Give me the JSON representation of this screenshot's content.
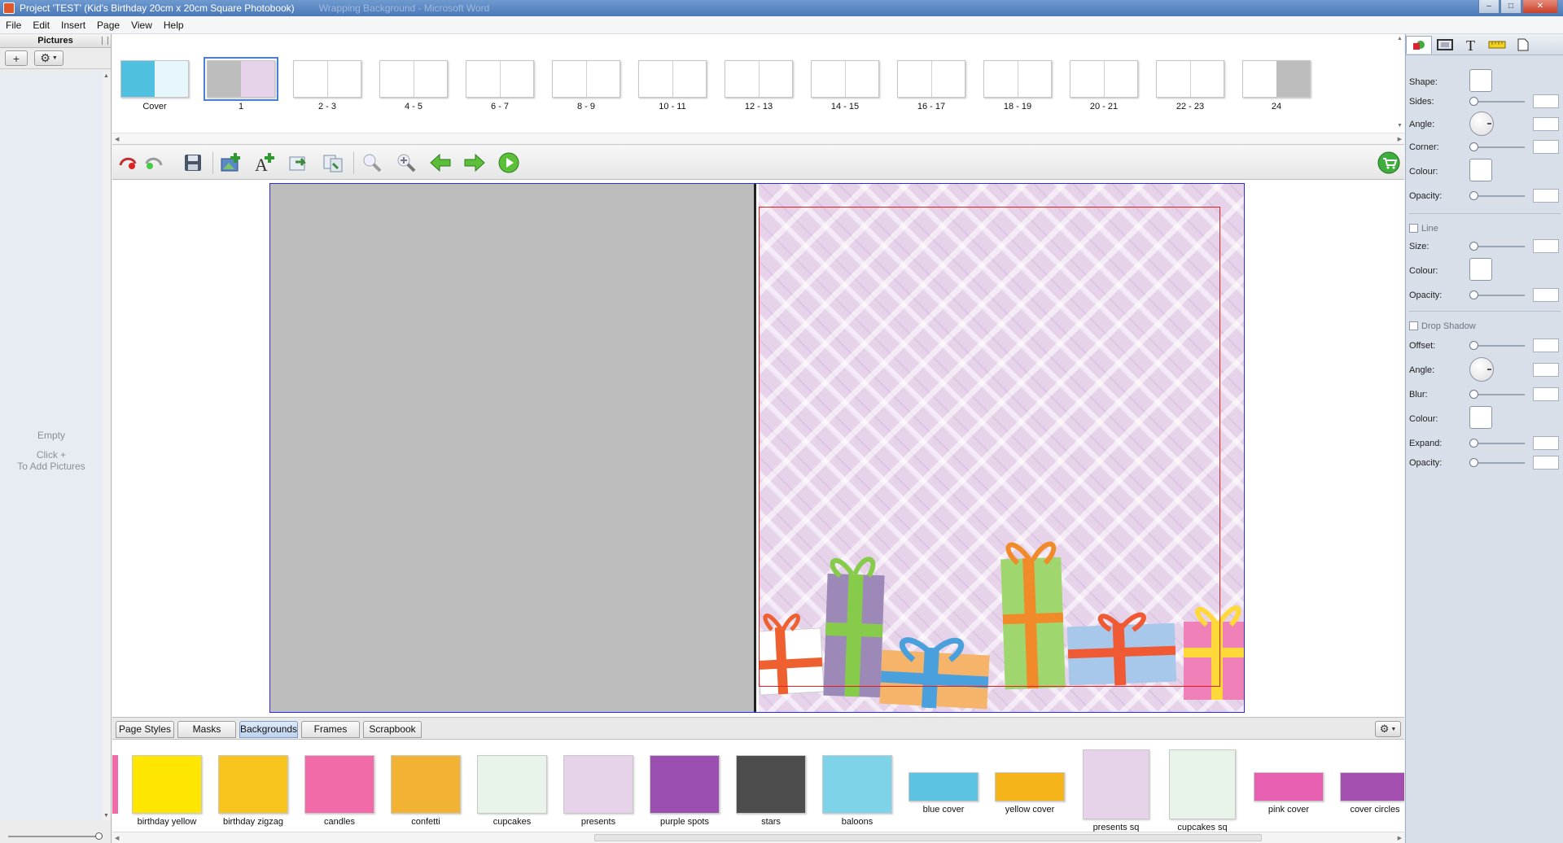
{
  "window": {
    "title": "Project 'TEST' (Kid's Birthday 20cm x 20cm Square Photobook)",
    "background_title": "Wrapping Background - Microsoft Word",
    "controls": [
      "minimize",
      "maximize",
      "close"
    ]
  },
  "menubar": [
    "File",
    "Edit",
    "Insert",
    "Page",
    "View",
    "Help"
  ],
  "pictures_panel": {
    "title": "Pictures",
    "add_label": "+",
    "settings_icon": "gear-icon",
    "empty_text": "Empty",
    "hint_line1": "Click +",
    "hint_line2": "To Add Pictures"
  },
  "page_strip": {
    "pages": [
      {
        "label": "Cover",
        "selected": false
      },
      {
        "label": "1",
        "selected": true
      },
      {
        "label": "2 - 3",
        "selected": false
      },
      {
        "label": "4 - 5",
        "selected": false
      },
      {
        "label": "6 - 7",
        "selected": false
      },
      {
        "label": "8 - 9",
        "selected": false
      },
      {
        "label": "10 - 11",
        "selected": false
      },
      {
        "label": "12 - 13",
        "selected": false
      },
      {
        "label": "14 - 15",
        "selected": false
      },
      {
        "label": "16 - 17",
        "selected": false
      },
      {
        "label": "18 - 19",
        "selected": false
      },
      {
        "label": "20 - 21",
        "selected": false
      },
      {
        "label": "22 - 23",
        "selected": false
      },
      {
        "label": "24",
        "selected": false
      }
    ]
  },
  "toolbar": {
    "icons": [
      "undo-icon",
      "redo-icon",
      "save-icon",
      "add-picture-icon",
      "add-text-icon",
      "export-icon",
      "replace-icon",
      "zoom-out-icon",
      "zoom-in-icon",
      "previous-page-icon",
      "next-page-icon",
      "preview-icon",
      "cart-icon"
    ]
  },
  "bottom_tabs": {
    "tabs": [
      "Page Styles",
      "Masks",
      "Backgrounds",
      "Frames",
      "Scrapbook"
    ],
    "active": "Backgrounds"
  },
  "backgrounds": [
    {
      "label": "birthday yellow",
      "color": "#ffe600"
    },
    {
      "label": "birthday zigzag",
      "color": "#f7c51d"
    },
    {
      "label": "candles",
      "color": "#f06ba8"
    },
    {
      "label": "confetti",
      "color": "#f2b234"
    },
    {
      "label": "cupcakes",
      "color": "#e8f3ea"
    },
    {
      "label": "presents",
      "color": "#e6d3ea"
    },
    {
      "label": "purple spots",
      "color": "#9b4fb0"
    },
    {
      "label": "stars",
      "color": "#4d4d4d"
    },
    {
      "label": "baloons",
      "color": "#7fd3e8"
    },
    {
      "label": "blue cover",
      "color": "#5cc3e3"
    },
    {
      "label": "yellow cover",
      "color": "#f5b41a"
    },
    {
      "label": "presents sq",
      "color": "#e6d3ea"
    },
    {
      "label": "cupcakes sq",
      "color": "#e8f3ea"
    },
    {
      "label": "pink cover",
      "color": "#e65fb0"
    },
    {
      "label": "cover circles",
      "color": "#a34fb0"
    }
  ],
  "properties": {
    "tabs": [
      "shape-tab-icon",
      "frame-tab-icon",
      "text-tab-icon",
      "ruler-tab-icon",
      "page-tab-icon"
    ],
    "shape_label": "Shape:",
    "sides_label": "Sides:",
    "angle_label": "Angle:",
    "corner_label": "Corner:",
    "colour_label": "Colour:",
    "opacity_label": "Opacity:",
    "line_label": "Line",
    "size_label": "Size:",
    "line_colour_label": "Colour:",
    "line_opacity_label": "Opacity:",
    "drop_shadow_label": "Drop Shadow",
    "offset_label": "Offset:",
    "shadow_angle_label": "Angle:",
    "blur_label": "Blur:",
    "shadow_colour_label": "Colour:",
    "expand_label": "Expand:",
    "shadow_opacity_label": "Opacity:"
  },
  "colors": {
    "right_page_bg": "#e6d3ea",
    "left_page_bg": "#bdbdbd",
    "selection_border": "#2a2ae0",
    "safe_area_line": "#e02020",
    "active_tab": "#bcd2ee"
  }
}
